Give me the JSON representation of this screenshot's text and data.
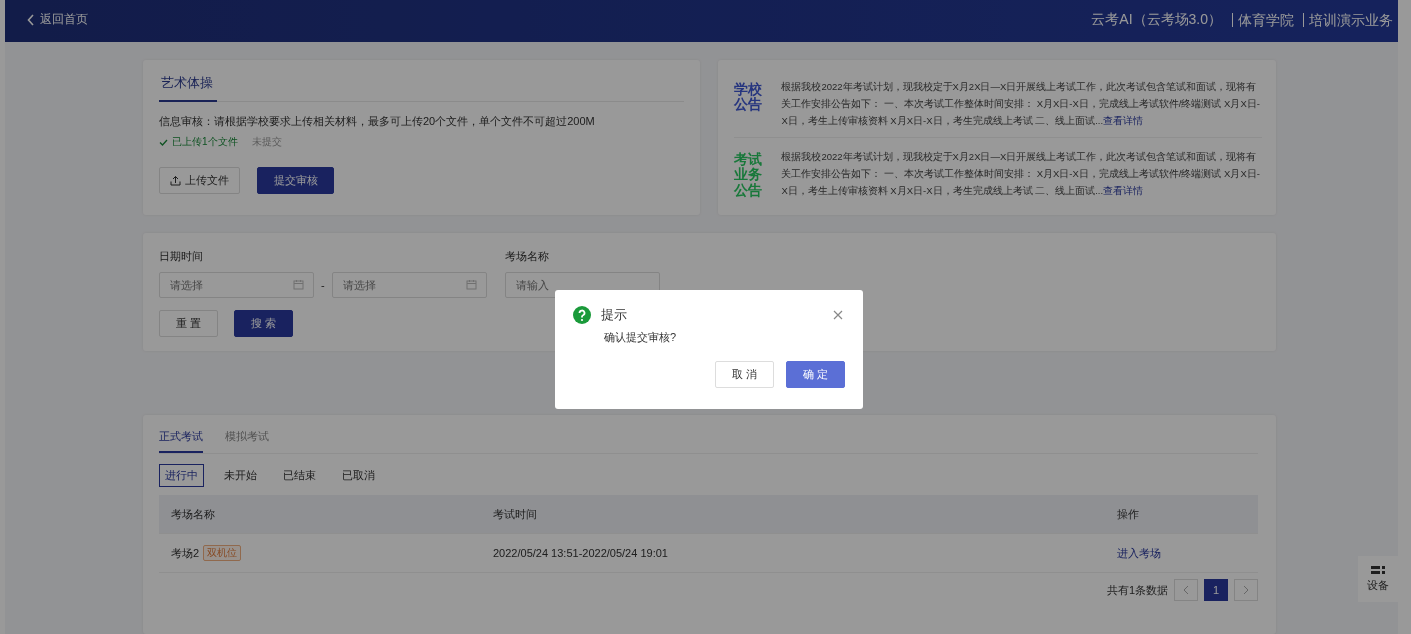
{
  "header": {
    "back_link": "返回首页",
    "title": "云考AI（云考场3.0）",
    "breadcrumbs": [
      "体育学院",
      "培训演示业务"
    ]
  },
  "upload_card": {
    "tab": "艺术体操",
    "info": "信息审核：请根据学校要求上传相关材料，最多可上传20个文件，单个文件不可超过200M",
    "uploaded": "已上传1个文件",
    "status": "未提交",
    "upload_button": "上传文件",
    "submit_button": "提交审核"
  },
  "notices": [
    {
      "title": "学校公告",
      "color": "#26357f",
      "text": "根据我校2022年考试计划，现我校定于X月2X日—X日开展线上考试工作，此次考试包含笔试和面试，现将有关工作安排公告如下： 一、本次考试工作整体时间安排： X月X日-X日，完成线上考试软件/终端测试 X月X日-X日，考生上传审核资料 X月X日-X日，考生完成线上考试 二、线上面试...",
      "link": "查看详情"
    },
    {
      "title": "考试业务公告",
      "color": "#18783a",
      "text": "根据我校2022年考试计划，现我校定于X月2X日—X日开展线上考试工作，此次考试包含笔试和面试，现将有关工作安排公告如下： 一、本次考试工作整体时间安排： X月X日-X日，完成线上考试软件/终端测试 X月X日-X日，考生上传审核资料 X月X日-X日，考生完成线上考试 二、线上面试...",
      "link": "查看详情"
    }
  ],
  "filter": {
    "date_label": "日期时间",
    "date_start_placeholder": "请选择",
    "separator": "-",
    "date_end_placeholder": "请选择",
    "name_label": "考场名称",
    "name_placeholder": "请输入",
    "reset_button": "重 置",
    "search_button": "搜 索"
  },
  "tabs": [
    {
      "label": "正式考试",
      "selected": true
    },
    {
      "label": "模拟考试",
      "selected": false
    }
  ],
  "status_filters": [
    {
      "label": "进行中",
      "selected": true
    },
    {
      "label": "未开始",
      "selected": false
    },
    {
      "label": "已结束",
      "selected": false
    },
    {
      "label": "已取消",
      "selected": false
    }
  ],
  "table": {
    "columns": [
      "考场名称",
      "考试时间",
      "操作"
    ],
    "rows": [
      {
        "name": "考场2",
        "tag": "双机位",
        "time": "2022/05/24 13:51-2022/05/24 19:01",
        "action": "进入考场"
      }
    ]
  },
  "pagination": {
    "total": "共有1条数据",
    "pages": [
      {
        "label": "1",
        "selected": true
      }
    ]
  },
  "side_widget": {
    "label": "设备"
  },
  "dialog": {
    "title": "提示",
    "message": "确认提交审核?",
    "cancel": "取 消",
    "confirm": "确 定"
  }
}
